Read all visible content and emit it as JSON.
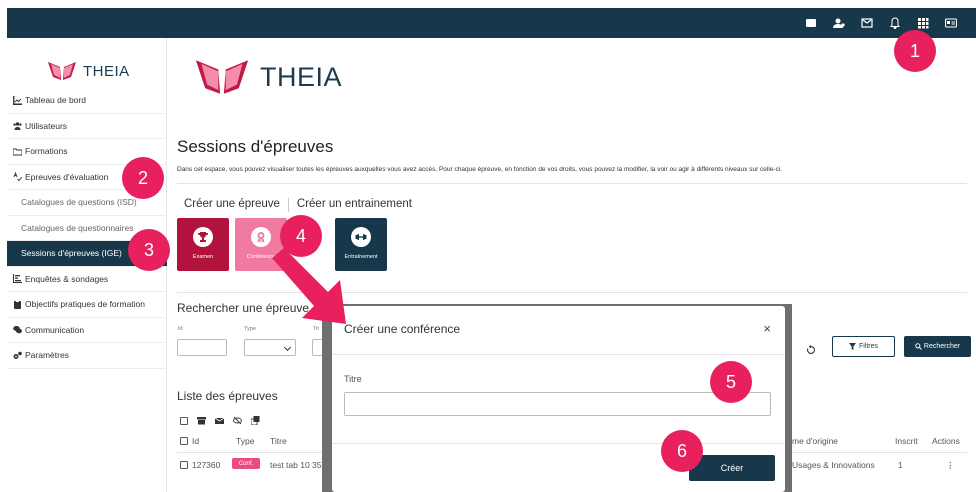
{
  "topbar": {
    "icons": [
      "book-icon",
      "user-gear-icon",
      "mail-icon",
      "bell-icon",
      "grid-icon",
      "id-card-icon"
    ]
  },
  "sidebar": {
    "brand": "THEIA",
    "items": [
      {
        "label": "Tableau de bord",
        "icon": "chart-line-icon"
      },
      {
        "label": "Utilisateurs",
        "icon": "users-icon"
      },
      {
        "label": "Formations",
        "icon": "folders-icon"
      },
      {
        "label": "Epreuves d'évaluation",
        "icon": "spellcheck-icon"
      },
      {
        "label": "Catalogues de questions (ISD)",
        "icon": ""
      },
      {
        "label": "Catalogues de questionnaires",
        "icon": ""
      },
      {
        "label": "Sessions d'épreuves (IGE)",
        "icon": ""
      },
      {
        "label": "Enquêtes & sondages",
        "icon": "poll-icon"
      },
      {
        "label": "Objectifs pratiques de formation",
        "icon": "clipboard-icon"
      },
      {
        "label": "Communication",
        "icon": "comments-icon"
      },
      {
        "label": "Paramètres",
        "icon": "cogs-icon"
      }
    ]
  },
  "main": {
    "brand": "THEIA",
    "title": "Sessions d'épreuves",
    "description": "Dans cet espace, vous pouvez visualiser toutes les épreuves auxquelles vous avez accès. Pour chaque épreuve, en fonction de vos droits, vous pouvez la modifier, la voir ou agir à différents niveaux sur celle-ci.",
    "create_tabs": [
      "Créer une épreuve",
      "Créer un entrainement"
    ],
    "tiles": [
      {
        "label": "Examen",
        "icon": "trophy-icon"
      },
      {
        "label": "Conférence",
        "icon": "award-icon"
      },
      {
        "label": "Entraînement",
        "icon": "dumbbell-icon"
      }
    ],
    "search": {
      "title": "Rechercher une épreuve",
      "fields": [
        "Id",
        "Type",
        "Tit"
      ],
      "filters_label": "Filtres",
      "search_label": "Rechercher"
    },
    "list": {
      "title": "Liste des épreuves",
      "headers": [
        "Id",
        "Type",
        "Titre",
        "me d'origine",
        "Inscrit",
        "Actions"
      ],
      "rows": [
        {
          "id": "127360",
          "type": "Conf.",
          "title": "test tab 10 35",
          "origin": "Usages & Innovations",
          "inscrit": "1",
          "actions": "⋮"
        }
      ]
    }
  },
  "modal": {
    "title": "Créer une conférence",
    "close": "×",
    "field_label": "Titre",
    "field_value": "",
    "submit_label": "Créer"
  },
  "steps": [
    "1",
    "2",
    "3",
    "4",
    "5",
    "6"
  ],
  "colors": {
    "navy": "#17384a",
    "crimson": "#b2133d",
    "pink": "#f17aa0",
    "callout": "#e8205e"
  }
}
